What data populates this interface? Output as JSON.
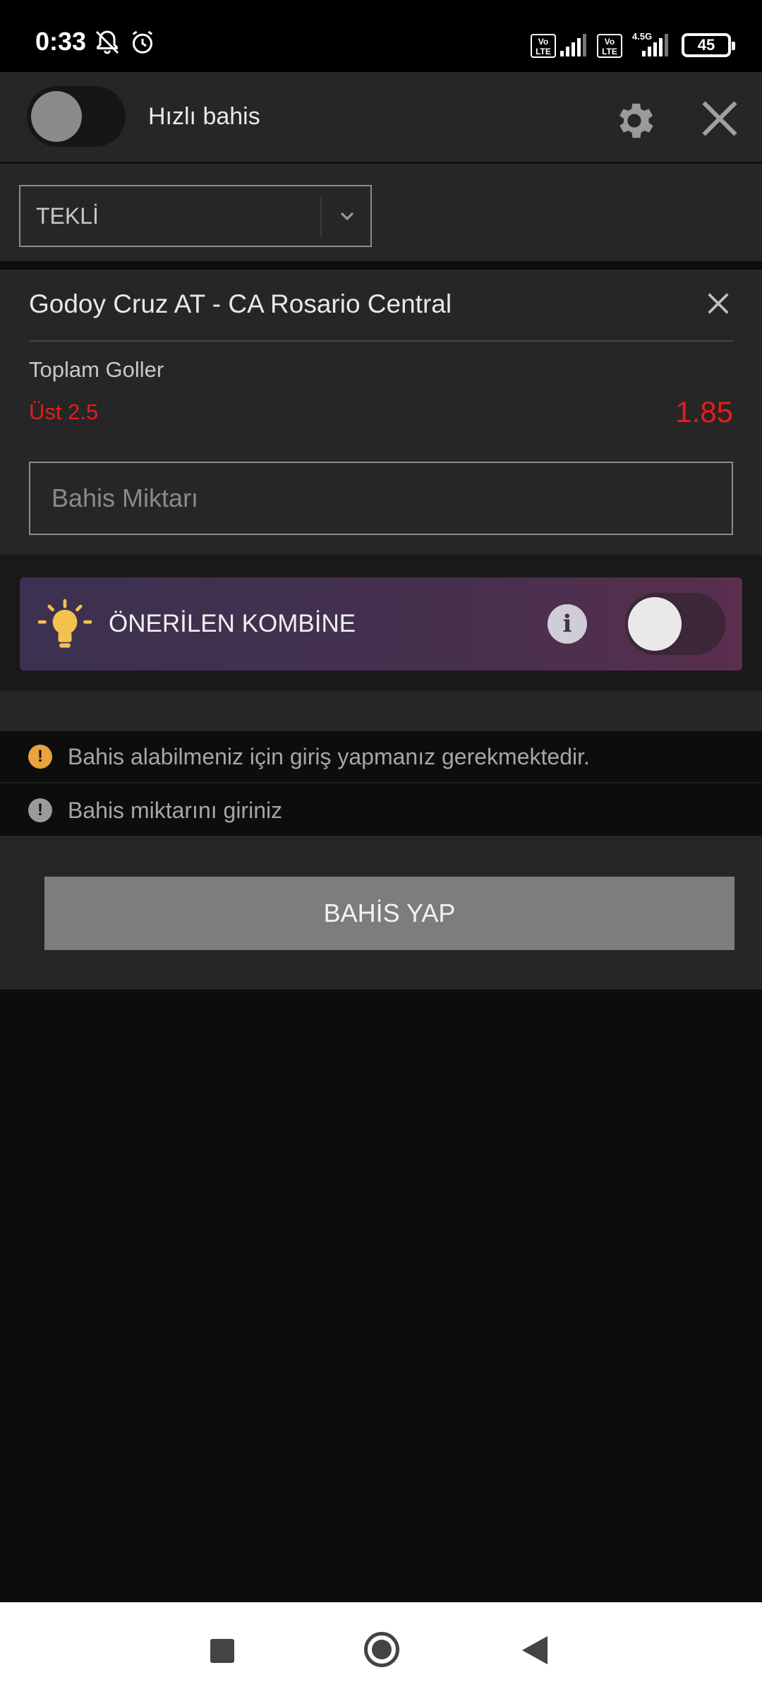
{
  "status_bar": {
    "time": "0:33",
    "network_label": "4.5G",
    "lte_label": "Vo LTE",
    "battery": "45"
  },
  "header": {
    "quick_bet_label": "Hızlı bahis",
    "quick_bet_enabled": false
  },
  "bet_type": {
    "selected": "TEKLİ"
  },
  "slip": {
    "match": "Godoy Cruz AT - CA Rosario Central",
    "market": "Toplam Goller",
    "selection": "Üst 2.5",
    "odds": "1.85",
    "amount_placeholder": "Bahis Miktarı",
    "amount_value": ""
  },
  "combo": {
    "label": "ÖNERİLEN KOMBİNE",
    "info_glyph": "i",
    "enabled": false
  },
  "warnings": [
    {
      "icon": "warning-orange",
      "glyph": "!",
      "text": "Bahis alabilmeniz için giriş yapmanız gerekmektedir."
    },
    {
      "icon": "warning-grey",
      "glyph": "!",
      "text": "Bahis miktarını giriniz"
    }
  ],
  "submit": {
    "label": "BAHİS YAP"
  },
  "colors": {
    "accent_red": "#e41d1d",
    "warning_orange": "#e8a33d",
    "bulb_yellow": "#f2c14e",
    "panel": "#262626",
    "background": "#0e0d0e"
  }
}
